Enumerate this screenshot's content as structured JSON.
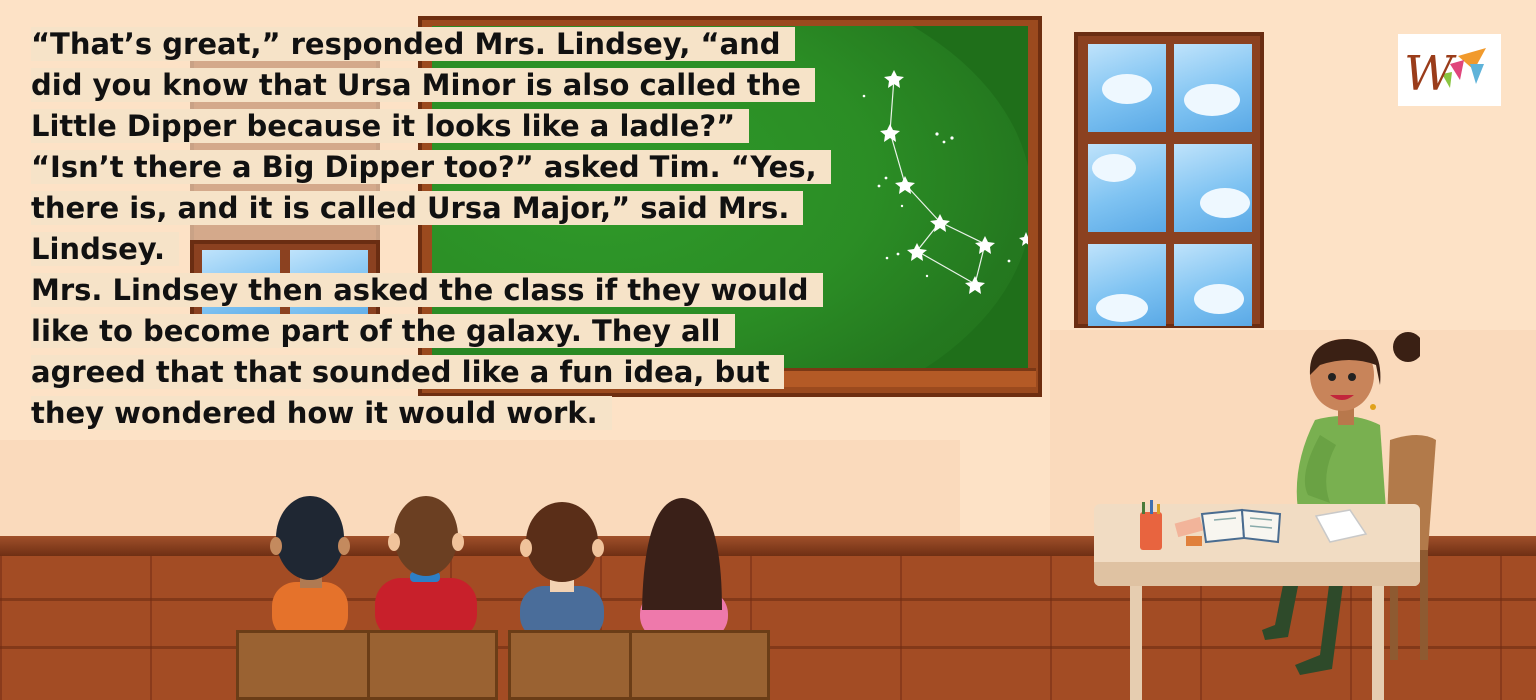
{
  "story": {
    "lines": [
      "“That’s great,” responded Mrs. Lindsey, “and",
      "did you know that Ursa Minor is also called the",
      "Little Dipper because it looks like a ladle?”",
      "“Isn’t there a Big Dipper too?” asked Tim. “Yes,",
      "there is, and it is called Ursa Major,” said Mrs.",
      "Lindsey.",
      "Mrs. Lindsey then asked the class if they would",
      "like to become part of the galaxy. They all",
      "agreed that that sounded like a fun idea, but",
      "they wondered how it would work."
    ]
  },
  "logo": {
    "letter": "W"
  },
  "colors": {
    "wall": "#fde2c6",
    "chalkboard": "#1f6f1a",
    "frame": "#9b4a1e",
    "floor": "#a34c24",
    "text_highlight": "#f6e3c8"
  },
  "icons": [
    "star-icon",
    "logo-icon"
  ]
}
